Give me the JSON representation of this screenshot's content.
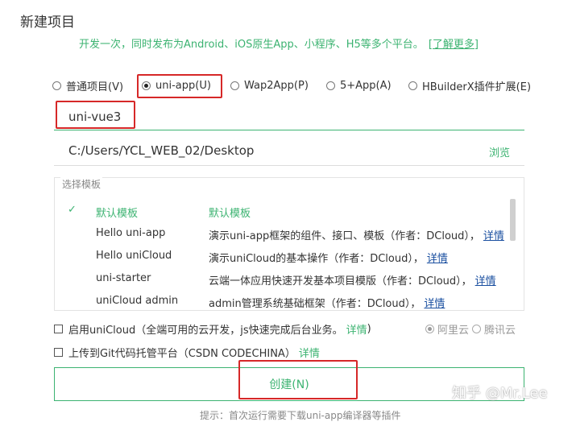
{
  "dialog": {
    "title": "新建项目",
    "subtitle": "开发一次，同时发布为Android、iOS原生App、小程序、H5等多个平台。",
    "learn_more": "[了解更多]"
  },
  "project_types": [
    {
      "label": "普通项目(V)",
      "checked": false
    },
    {
      "label": "uni-app(U)",
      "checked": true
    },
    {
      "label": "Wap2App(P)",
      "checked": false
    },
    {
      "label": "5+App(A)",
      "checked": false
    },
    {
      "label": "HBuilderX插件扩展(E)",
      "checked": false
    }
  ],
  "project_name": "uni-vue3",
  "location": {
    "path": "C:/Users/YCL_WEB_02/Desktop",
    "browse_label": "浏览"
  },
  "templates": {
    "group_label": "选择模板",
    "detail_label": "详情",
    "items": [
      {
        "name": "默认模板",
        "desc": "默认模板",
        "selected": true
      },
      {
        "name": "Hello uni-app",
        "desc": "演示uni-app框架的组件、接口、模板（作者：DCloud），",
        "selected": false
      },
      {
        "name": "Hello uniCloud",
        "desc": "演示uniCloud的基本操作（作者：DCloud），",
        "selected": false
      },
      {
        "name": "uni-starter",
        "desc": "云端一体应用快速开发基本项目模版（作者：DCloud），",
        "selected": false
      },
      {
        "name": "uniCloud admin",
        "desc": "admin管理系统基础框架（作者：DCloud），",
        "selected": false
      }
    ]
  },
  "unicloud": {
    "label": "启用uniCloud（全端可用的云开发，js快速完成后台业务。",
    "detail_label": "详情",
    "close_paren": ")",
    "checked": false,
    "providers": [
      "阿里云",
      "腾讯云"
    ]
  },
  "git": {
    "label": "上传到Git代码托管平台（CSDN CODECHINA）",
    "detail_label": "详情",
    "checked": false
  },
  "create_button": "创建(N)",
  "watermark": "知乎 @Mr.Lee",
  "footer_cut": "提示：首次运行需要下载uni-app编译器等插件"
}
